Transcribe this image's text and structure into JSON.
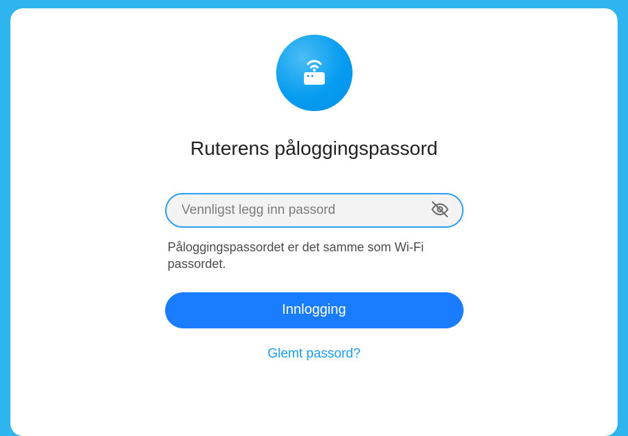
{
  "login": {
    "title": "Ruterens påloggingspassord",
    "password_placeholder": "Vennligst legg inn passord",
    "password_value": "",
    "hint": "Påloggingspassordet er det samme som Wi-Fi passordet.",
    "submit_label": "Innlogging",
    "forgot_label": "Glemt passord?"
  }
}
